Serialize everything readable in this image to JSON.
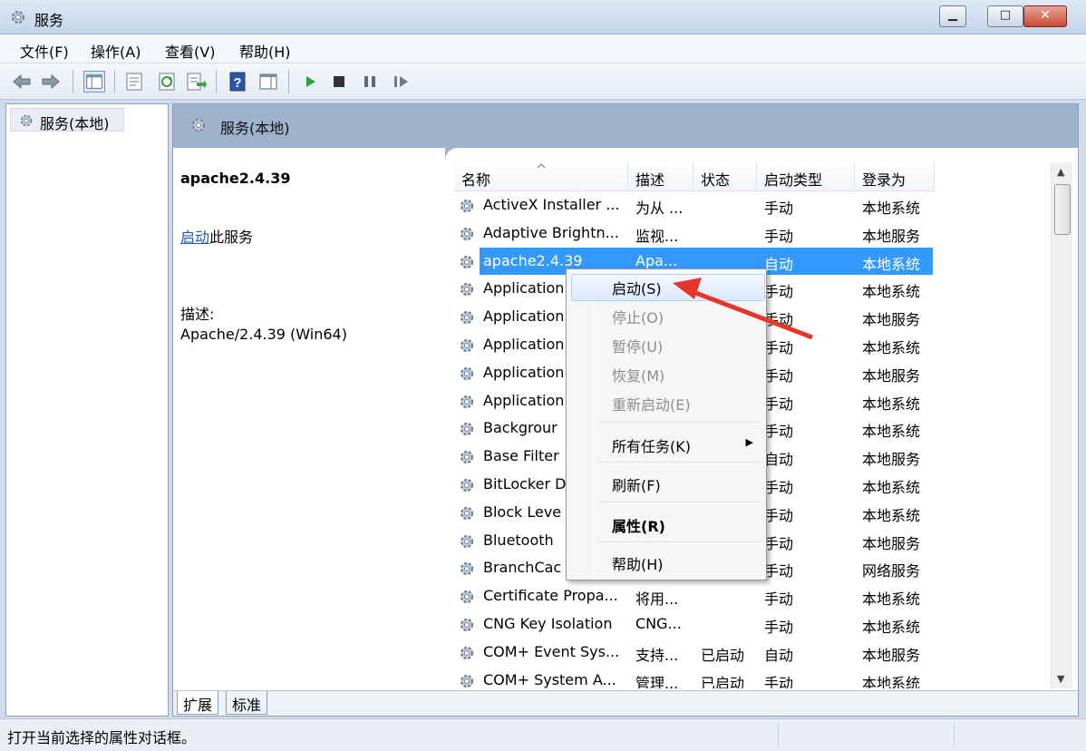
{
  "window": {
    "title": "服务"
  },
  "menubar": [
    "文件(F)",
    "操作(A)",
    "查看(V)",
    "帮助(H)"
  ],
  "tree": {
    "root": "服务(本地)"
  },
  "main": {
    "header": "服务(本地)",
    "selected_name": "apache2.4.39",
    "action_link": "启动",
    "action_suffix": "此服务",
    "desc_label": "描述:",
    "desc_text": "Apache/2.4.39 (Win64)"
  },
  "table": {
    "columns": [
      "名称",
      "描述",
      "状态",
      "启动类型",
      "登录为"
    ],
    "rows": [
      {
        "name": "ActiveX Installer ...",
        "desc": "为从 ...",
        "status": "",
        "startup": "手动",
        "logon": "本地系统"
      },
      {
        "name": "Adaptive Brightn...",
        "desc": "监视...",
        "status": "",
        "startup": "手动",
        "logon": "本地服务"
      },
      {
        "name": "apache2.4.39",
        "desc": "Apa...",
        "status": "",
        "startup": "自动",
        "logon": "本地系统"
      },
      {
        "name": "Application",
        "desc": "",
        "status": "",
        "startup": "手动",
        "logon": "本地系统"
      },
      {
        "name": "Application",
        "desc": "",
        "status": "",
        "startup": "手动",
        "logon": "本地服务"
      },
      {
        "name": "Application",
        "desc": "",
        "status": "",
        "startup": "手动",
        "logon": "本地系统"
      },
      {
        "name": "Application",
        "desc": "",
        "status": "",
        "startup": "手动",
        "logon": "本地服务"
      },
      {
        "name": "Application",
        "desc": "",
        "status": "",
        "startup": "手动",
        "logon": "本地系统"
      },
      {
        "name": "Backgrour",
        "desc": "",
        "status": "",
        "startup": "手动",
        "logon": "本地系统"
      },
      {
        "name": "Base Filter",
        "desc": "",
        "status": "",
        "startup": "自动",
        "logon": "本地服务"
      },
      {
        "name": "BitLocker D",
        "desc": "",
        "status": "",
        "startup": "手动",
        "logon": "本地系统"
      },
      {
        "name": "Block Leve",
        "desc": "",
        "status": "",
        "startup": "手动",
        "logon": "本地系统"
      },
      {
        "name": "Bluetooth",
        "desc": "",
        "status": "",
        "startup": "手动",
        "logon": "本地服务"
      },
      {
        "name": "BranchCac",
        "desc": "",
        "status": "",
        "startup": "手动",
        "logon": "网络服务"
      },
      {
        "name": "Certificate Propa...",
        "desc": "将用...",
        "status": "",
        "startup": "手动",
        "logon": "本地系统"
      },
      {
        "name": "CNG Key Isolation",
        "desc": "CNG...",
        "status": "",
        "startup": "手动",
        "logon": "本地系统"
      },
      {
        "name": "COM+ Event Sys...",
        "desc": "支持...",
        "status": "已启动",
        "startup": "自动",
        "logon": "本地服务"
      },
      {
        "name": "COM+ System A...",
        "desc": "管理...",
        "status": "已启动",
        "startup": "手动",
        "logon": "本地系统"
      }
    ]
  },
  "context_menu": {
    "items": [
      "启动(S)",
      "停止(O)",
      "暂停(U)",
      "恢复(M)",
      "重新启动(E)",
      "所有任务(K)",
      "刷新(F)",
      "属性(R)",
      "帮助(H)"
    ]
  },
  "tabs": [
    "扩展",
    "标准"
  ],
  "statusbar": {
    "text": "打开当前选择的属性对话框。"
  },
  "colors": {
    "selection": "#3399ff",
    "arrow": "#e8352b",
    "header": "#9eb3cb"
  }
}
